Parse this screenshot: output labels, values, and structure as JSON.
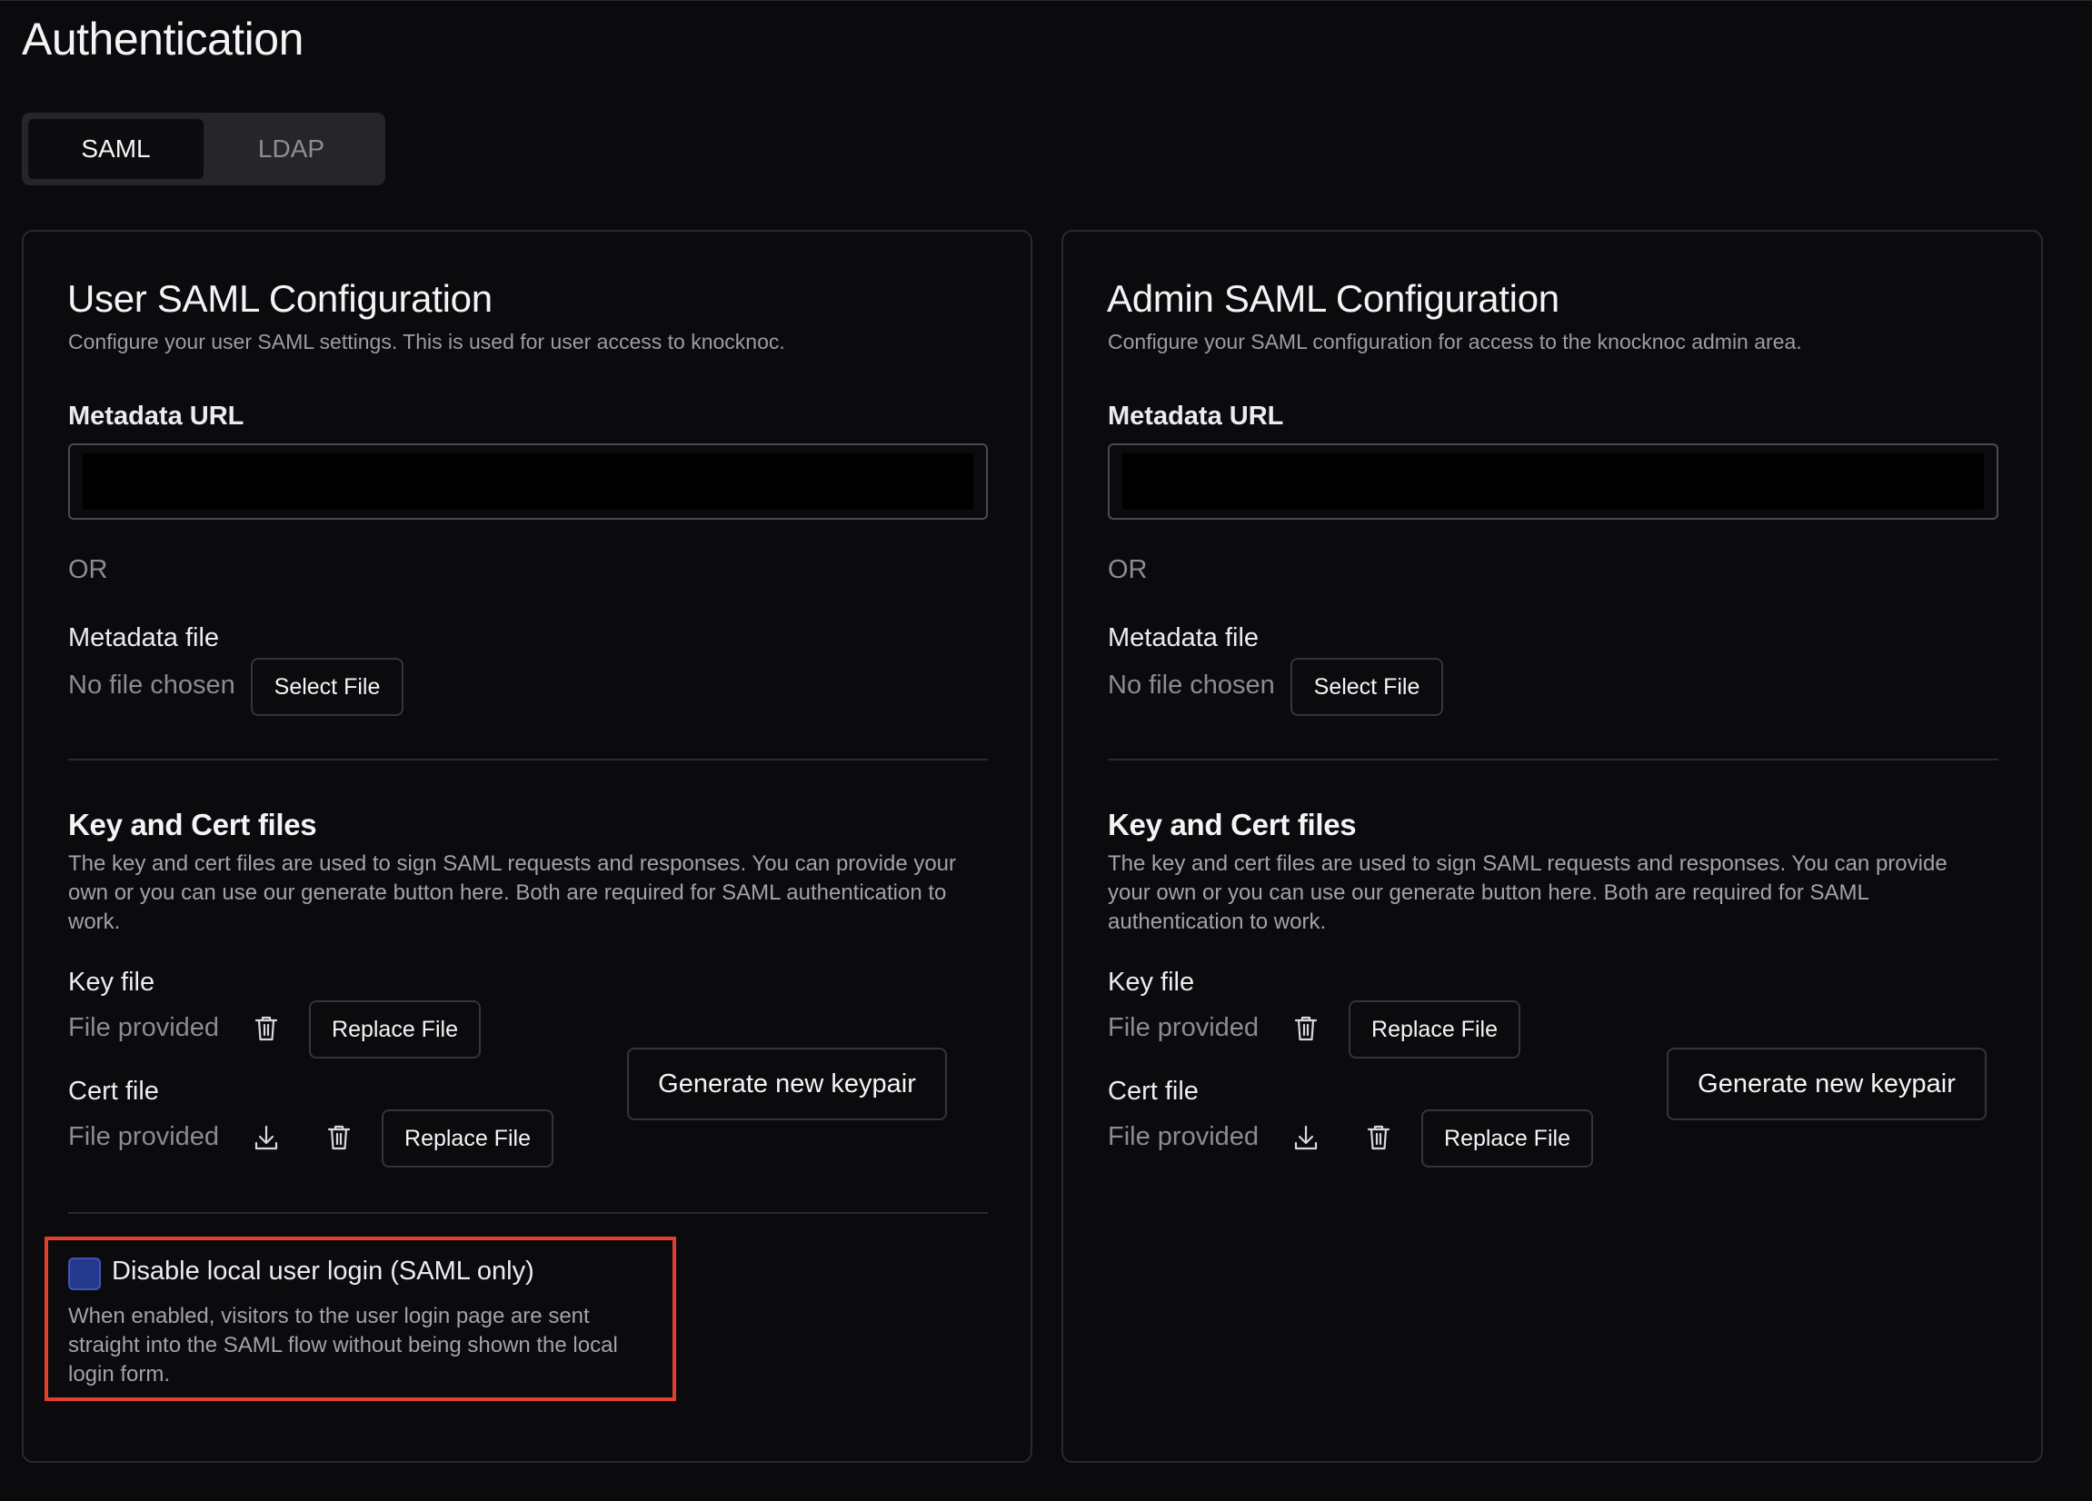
{
  "page": {
    "title": "Authentication"
  },
  "tabs": [
    {
      "label": "SAML",
      "active": true
    },
    {
      "label": "LDAP",
      "active": false
    }
  ],
  "user_saml": {
    "title": "User SAML Configuration",
    "subtitle": "Configure your user SAML settings. This is used for user access to knocknoc.",
    "metadata_url_label": "Metadata URL",
    "metadata_url_value": "",
    "or_text": "OR",
    "metadata_file_label": "Metadata file",
    "no_file_text": "No file chosen",
    "select_file_label": "Select File",
    "keycert_title": "Key and Cert files",
    "keycert_desc_lines": [
      "The key and cert files are used to sign SAML requests and responses. You can provide your",
      "own or you can use our generate button here. Both are required for SAML authentication to",
      "work."
    ],
    "key_file_label": "Key file",
    "key_file_status": "File provided",
    "cert_file_label": "Cert file",
    "cert_file_status": "File provided",
    "replace_file_label": "Replace File",
    "generate_label": "Generate new keypair",
    "disable_local_label": "Disable local user login (SAML only)",
    "disable_local_checked": false,
    "disable_local_desc_lines": [
      "When enabled, visitors to the user login page are sent",
      "straight into the SAML flow without being shown the local",
      "login form."
    ]
  },
  "admin_saml": {
    "title": "Admin SAML Configuration",
    "subtitle": "Configure your SAML configuration for access to the knocknoc admin area.",
    "metadata_url_label": "Metadata URL",
    "metadata_url_value": "",
    "or_text": "OR",
    "metadata_file_label": "Metadata file",
    "no_file_text": "No file chosen",
    "select_file_label": "Select File",
    "keycert_title": "Key and Cert files",
    "keycert_desc_lines": [
      "The key and cert files are used to sign SAML requests and responses. You can provide",
      "your own or you can use our generate button here. Both are required for SAML",
      "authentication to work."
    ],
    "key_file_label": "Key file",
    "key_file_status": "File provided",
    "cert_file_label": "Cert file",
    "cert_file_status": "File provided",
    "replace_file_label": "Replace File",
    "generate_label": "Generate new keypair"
  },
  "colors": {
    "background": "#0b0b0d",
    "highlight_border": "#e2402c",
    "checkbox_fill": "#24398c"
  },
  "icons": {
    "trash": "trash-icon",
    "download": "download-icon"
  }
}
